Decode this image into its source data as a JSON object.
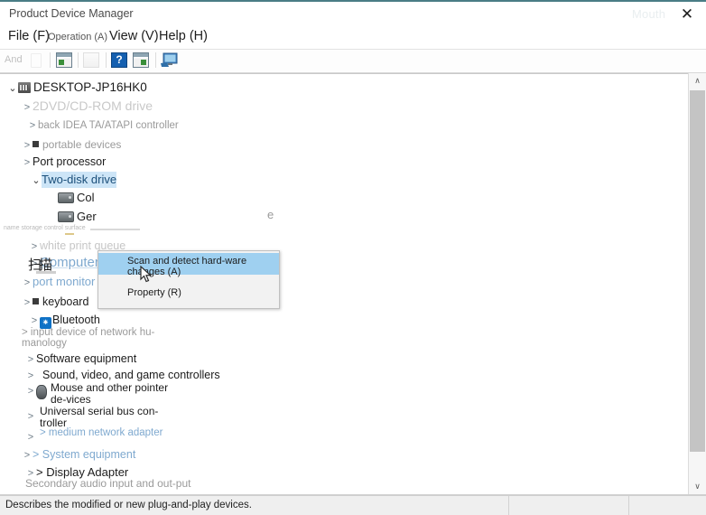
{
  "window": {
    "title": "Product Device Manager",
    "close_label": "✕",
    "ghost_text_1": "",
    "ghost_text_2": "Mouth"
  },
  "menubar": {
    "items": [
      {
        "label": "File (F)"
      },
      {
        "label": "Operation (A)"
      },
      {
        "label": "View (V)"
      },
      {
        "label": "Help (H)"
      }
    ]
  },
  "toolbar": {
    "ghost_label": "And",
    "buttons": [
      {
        "name": "properties-icon",
        "label": ""
      },
      {
        "name": "print-icon",
        "label": ""
      },
      {
        "name": "help-icon",
        "label": "?"
      },
      {
        "name": "update-driver-icon",
        "label": ""
      },
      {
        "name": "scan-hardware-icon",
        "label": ""
      }
    ]
  },
  "tree": {
    "nodes": [
      {
        "label": "DESKTOP-JP16HK0",
        "chevron": "⌄"
      },
      {
        "label": "2DVD/CD-ROM drive",
        "chevron": ">"
      },
      {
        "label": "back IDEA TA/ATAPI controller",
        "chevron": ">"
      },
      {
        "label": "portable devices",
        "chevron": ">"
      },
      {
        "label": "Port processor",
        "chevron": ">"
      },
      {
        "label": "Two-disk drive",
        "chevron": "⌄"
      },
      {
        "label": "Col",
        "chevron": ""
      },
      {
        "label": "Ger",
        "chevron": ""
      },
      {
        "label": "name storage control surface",
        "chevron": ">"
      },
      {
        "label": "white print queue",
        "chevron": ">"
      },
      {
        "label": "Computer",
        "chevron": ">"
      },
      {
        "label": "port monitor",
        "chevron": ">"
      },
      {
        "label": "keyboard",
        "chevron": ">"
      },
      {
        "label": "Bluetooth",
        "chevron": ">"
      },
      {
        "label": "input device of network hu-manology",
        "chevron": ">"
      },
      {
        "label": "Software equipment",
        "chevron": ">"
      },
      {
        "label": "Sound, video, and game controllers",
        "chevron": ">"
      },
      {
        "label": "Mouse and other pointer de-vices",
        "chevron": ">"
      },
      {
        "label": "Universal serial bus con-troller",
        "chevron": ">"
      },
      {
        "label": "medium network adapter",
        "chevron": ">"
      },
      {
        "label": "System equipment",
        "chevron": ">"
      },
      {
        "label": "Display Adapter",
        "chevron": ">"
      },
      {
        "label": "Secondary audio input and out-put",
        "chevron": ""
      }
    ],
    "fragment_right": "e"
  },
  "context_menu": {
    "items": [
      {
        "label": "Scan and detect hard-ware changes (A)",
        "highlighted": true
      },
      {
        "label": "Property (R)",
        "highlighted": false
      }
    ],
    "overlay_glyph": "扫描"
  },
  "scrollbar": {
    "up_arrow": "∧",
    "down_arrow": "∨"
  },
  "statusbar": {
    "message": "Describes the modified or new plug-and-play devices."
  },
  "colors": {
    "selection": "#cde5f7",
    "menu_highlight": "#9fd0f0",
    "accent_titlebar": "#4a7d85",
    "help_icon": "#1560b0",
    "bluetooth": "#1072c6"
  }
}
